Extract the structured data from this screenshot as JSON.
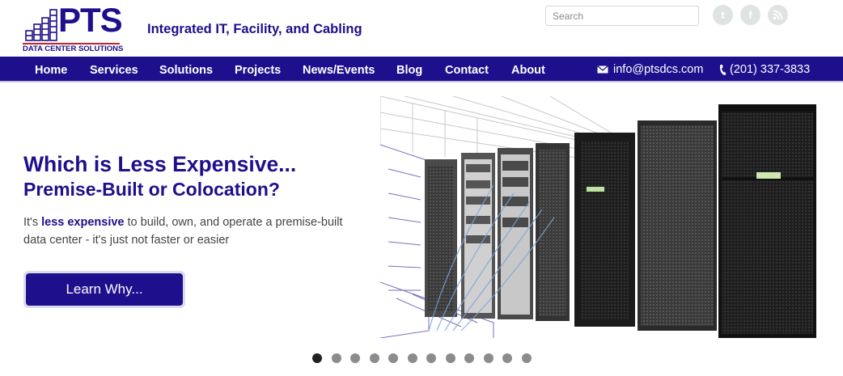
{
  "logo": {
    "text": "PTS",
    "subtitle": "DATA CENTER SOLUTIONS"
  },
  "tagline": "Integrated IT, Facility, and Cabling",
  "search": {
    "placeholder": "Search"
  },
  "social": [
    {
      "icon": "twitter-icon",
      "glyph": "t"
    },
    {
      "icon": "facebook-icon",
      "glyph": "f"
    },
    {
      "icon": "rss-icon",
      "glyph": ""
    }
  ],
  "nav": {
    "items": [
      "Home",
      "Services",
      "Solutions",
      "Projects",
      "News/Events",
      "Blog",
      "Contact",
      "About"
    ],
    "email": "info@ptsdcs.com",
    "phone": "(201) 337-3833"
  },
  "hero": {
    "title": "Which is Less Expensive...",
    "subtitle": "Premise-Built or Colocation?",
    "body_prefix": "It's ",
    "body_highlight": "less expensive",
    "body_suffix": " to build, own, and operate a premise-built data center - it's just not faster or easier",
    "cta_label": "Learn Why..."
  },
  "slider": {
    "total": 12,
    "active": 1
  },
  "colors": {
    "brand": "#1e0f8c",
    "accent": "#c0282d",
    "social": "#dfe4e3"
  }
}
